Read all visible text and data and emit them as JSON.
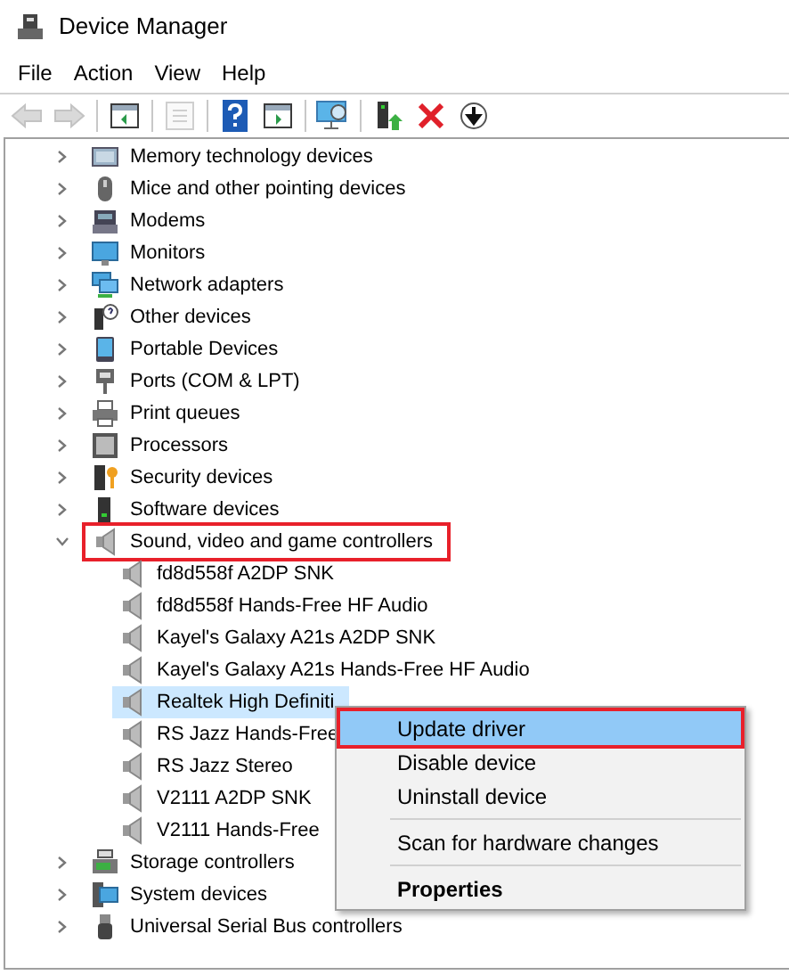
{
  "window": {
    "title": "Device Manager"
  },
  "menu": [
    "File",
    "Action",
    "View",
    "Help"
  ],
  "toolbar": [
    {
      "kind": "back",
      "disabled": true
    },
    {
      "kind": "forward",
      "disabled": true
    },
    {
      "kind": "console-tree",
      "disabled": false
    },
    {
      "kind": "properties",
      "disabled": true
    },
    {
      "kind": "help",
      "disabled": false
    },
    {
      "kind": "action-pane",
      "disabled": false
    },
    {
      "kind": "scan",
      "disabled": false
    },
    {
      "kind": "update",
      "disabled": false
    },
    {
      "kind": "uninstall",
      "disabled": false
    },
    {
      "kind": "disable",
      "disabled": false
    }
  ],
  "tree": [
    {
      "label": "Memory technology devices",
      "kind": "chip",
      "expanded": false,
      "annotated": false
    },
    {
      "label": "Mice and other pointing devices",
      "kind": "mouse",
      "expanded": false,
      "annotated": false
    },
    {
      "label": "Modems",
      "kind": "modem",
      "expanded": false,
      "annotated": false
    },
    {
      "label": "Monitors",
      "kind": "monitor",
      "expanded": false,
      "annotated": false
    },
    {
      "label": "Network adapters",
      "kind": "network",
      "expanded": false,
      "annotated": false
    },
    {
      "label": "Other devices",
      "kind": "unknown",
      "expanded": false,
      "annotated": false
    },
    {
      "label": "Portable Devices",
      "kind": "portable",
      "expanded": false,
      "annotated": false
    },
    {
      "label": "Ports (COM & LPT)",
      "kind": "port",
      "expanded": false,
      "annotated": false
    },
    {
      "label": "Print queues",
      "kind": "printer",
      "expanded": false,
      "annotated": false
    },
    {
      "label": "Processors",
      "kind": "processor",
      "expanded": false,
      "annotated": false
    },
    {
      "label": "Security devices",
      "kind": "security",
      "expanded": false,
      "annotated": false
    },
    {
      "label": "Software devices",
      "kind": "software",
      "expanded": false,
      "annotated": false
    },
    {
      "label": "Sound, video and game controllers",
      "kind": "speaker",
      "expanded": true,
      "annotated": true,
      "children": [
        {
          "label": "fd8d558f A2DP SNK",
          "selected": false
        },
        {
          "label": "fd8d558f Hands-Free HF Audio",
          "selected": false
        },
        {
          "label": "Kayel's Galaxy A21s A2DP SNK",
          "selected": false
        },
        {
          "label": "Kayel's Galaxy A21s Hands-Free HF Audio",
          "selected": false
        },
        {
          "label": "Realtek High Definiti",
          "selected": true
        },
        {
          "label": "RS Jazz Hands-Free",
          "selected": false
        },
        {
          "label": "RS Jazz Stereo",
          "selected": false
        },
        {
          "label": "V2111 A2DP SNK",
          "selected": false
        },
        {
          "label": "V2111 Hands-Free",
          "selected": false
        }
      ]
    },
    {
      "label": "Storage controllers",
      "kind": "storage",
      "expanded": false,
      "annotated": false
    },
    {
      "label": "System devices",
      "kind": "system",
      "expanded": false,
      "annotated": false
    },
    {
      "label": "Universal Serial Bus controllers",
      "kind": "usb",
      "expanded": false,
      "annotated": false
    }
  ],
  "context_menu": [
    {
      "kind": "item",
      "label": "Update driver",
      "highlighted": true,
      "annotated": true,
      "bold": false
    },
    {
      "kind": "item",
      "label": "Disable device",
      "highlighted": false,
      "annotated": false,
      "bold": false
    },
    {
      "kind": "item",
      "label": "Uninstall device",
      "highlighted": false,
      "annotated": false,
      "bold": false
    },
    {
      "kind": "separator"
    },
    {
      "kind": "item",
      "label": "Scan for hardware changes",
      "highlighted": false,
      "annotated": false,
      "bold": false
    },
    {
      "kind": "separator"
    },
    {
      "kind": "item",
      "label": "Properties",
      "highlighted": false,
      "annotated": false,
      "bold": true
    }
  ]
}
